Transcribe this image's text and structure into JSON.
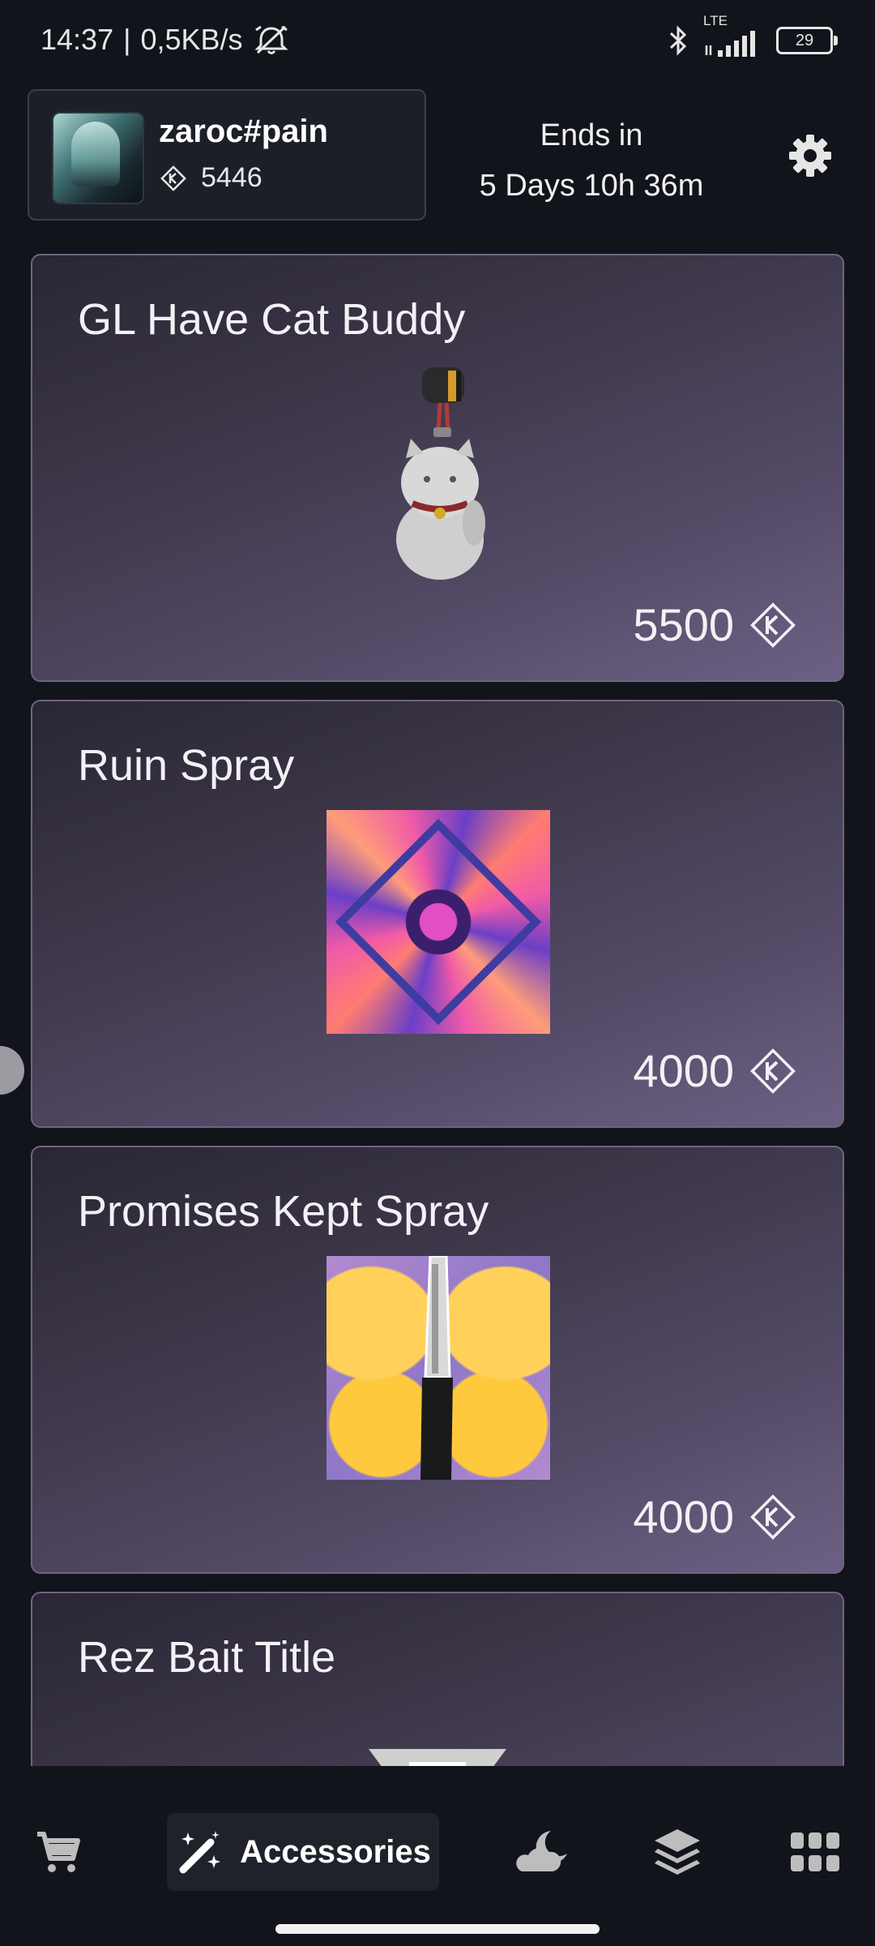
{
  "status_bar": {
    "time": "14:37",
    "separator": "|",
    "speed": "0,5KB/s",
    "network": "LTE",
    "battery": "29",
    "icons": [
      "alarm-off-icon",
      "bluetooth-icon",
      "signal-icon",
      "battery-icon"
    ]
  },
  "header": {
    "username": "zaroc#pain",
    "points": "5446",
    "ends_label": "Ends in",
    "ends_value": "5 Days 10h 36m",
    "settings_icon": "gear-icon"
  },
  "store": {
    "items": [
      {
        "title": "GL Have Cat Buddy",
        "price": "5500",
        "image": "cat-buddy-charm"
      },
      {
        "title": "Ruin Spray",
        "price": "4000",
        "image": "ruin-spray"
      },
      {
        "title": "Promises Kept Spray",
        "price": "4000",
        "image": "promises-kept-spray"
      },
      {
        "title": "Rez Bait Title",
        "price": "",
        "image": "title-banner"
      }
    ],
    "currency_icon": "kingdom-credits-icon"
  },
  "bottom_nav": {
    "active_label": "Accessories",
    "items": [
      "cart-icon",
      "magic-wand-icon",
      "night-market-icon",
      "layers-icon",
      "grid-icon"
    ]
  },
  "colors": {
    "background": "#12141b",
    "card_gradient_start": "#2a2633",
    "card_gradient_end": "#6c6184",
    "card_border": "#6d6580",
    "text": "#ffffff"
  }
}
